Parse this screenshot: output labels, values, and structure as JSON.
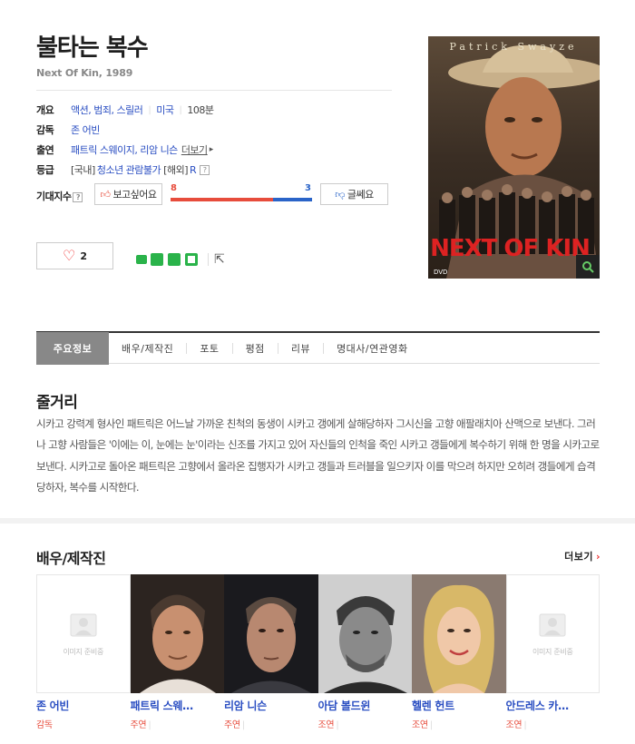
{
  "movie": {
    "title": "불타는 복수",
    "subtitle": "Next Of Kin, 1989"
  },
  "info": {
    "overview_label": "개요",
    "genres": "액션, 범죄, 스릴러",
    "country": "미국",
    "runtime": "108분",
    "director_label": "감독",
    "director": "존 어빈",
    "cast_label": "출연",
    "cast": "패트릭 스웨이지, 리암 니슨",
    "more_link": "더보기",
    "rating_label": "등급",
    "rating_domestic_tag": "[국내]",
    "rating_domestic": "청소년 관람불가",
    "rating_overseas_tag": "[해외]",
    "rating_overseas": "R",
    "help_mark": "?"
  },
  "expectation": {
    "label": "기대지수",
    "want_button": "보고싶어요",
    "want_count": "8",
    "not_button": "글쎄요",
    "not_count": "3",
    "want_ratio": 0.727,
    "colors": {
      "want": "#e74c3c",
      "not": "#2a64c8"
    }
  },
  "like": {
    "count": "2",
    "icon": "heart-icon"
  },
  "share": {
    "icons": [
      "line-share-icon",
      "band-share-icon",
      "blog-share-icon",
      "cafe-share-icon",
      "share-out-icon"
    ]
  },
  "poster": {
    "actor_text": "Patrick Swayze",
    "logo_text": "NEXT OF KIN",
    "format_text": "DVD",
    "zoom_icon": "magnifier-icon"
  },
  "tabs": [
    {
      "label": "주요정보",
      "active": true
    },
    {
      "label": "배우/제작진",
      "active": false
    },
    {
      "label": "포토",
      "active": false
    },
    {
      "label": "평점",
      "active": false
    },
    {
      "label": "리뷰",
      "active": false
    },
    {
      "label": "명대사/연관영화",
      "active": false
    }
  ],
  "plot": {
    "heading": "줄거리",
    "text": "시카고 강력계 형사인 패트릭은 어느날 가까운 친척의 동생이 시카고 갱에게 살해당하자 그시신을 고향 애팔래치아 산맥으로 보낸다. 그러나 고향 사람들은 '이에는 이, 눈에는 눈'이라는 신조를 가지고 있어 자신들의 인척을 죽인 시카고 갱들에게 복수하기 위해 한 명을 시카고로 보낸다. 시카고로 돌아온 패트릭은 고향에서 올라온 집행자가 시카고 갱들과 트러블을 일으키자 이를 막으려 하지만 오히려 갱들에게 습격당하자, 복수를 시작한다."
  },
  "crew": {
    "heading": "배우/제작진",
    "more": "더보기",
    "no_image_text": "이미지 준비중",
    "people": [
      {
        "name": "존 어빈",
        "role": "감독",
        "photo": "none"
      },
      {
        "name": "패트릭 스웨…",
        "role": "주연",
        "photo": "patrick"
      },
      {
        "name": "리암 니슨",
        "role": "주연",
        "photo": "liam"
      },
      {
        "name": "아담 볼드윈",
        "role": "조연",
        "photo": "adam"
      },
      {
        "name": "헬렌 헌트",
        "role": "조연",
        "photo": "helen"
      },
      {
        "name": "안드레스 카…",
        "role": "조연",
        "photo": "none"
      }
    ]
  }
}
